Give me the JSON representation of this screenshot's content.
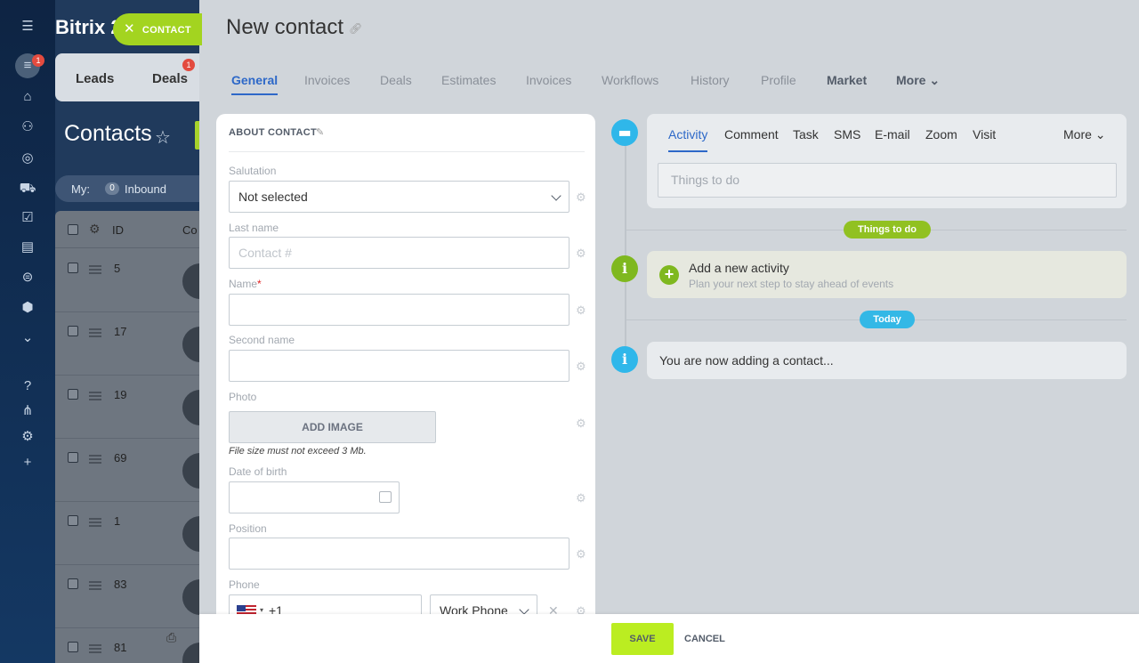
{
  "app": {
    "brand": "Bitrix 2",
    "rail_badge": "1"
  },
  "background": {
    "tabs": [
      "Leads",
      "Deals"
    ],
    "deals_badge": "1",
    "page_title": "Contacts",
    "filter": {
      "my": "My:",
      "count": "0",
      "inbound": "Inbound"
    },
    "grid_headers": {
      "id": "ID",
      "contact": "Co"
    },
    "rows": [
      "5",
      "17",
      "19",
      "69",
      "1",
      "83",
      "81"
    ]
  },
  "chip": {
    "label": "CONTACT"
  },
  "slider": {
    "title": "New contact",
    "tabs": [
      "General",
      "Invoices",
      "Deals",
      "Estimates",
      "Invoices",
      "Workflows",
      "History",
      "Profile",
      "Market",
      "More"
    ]
  },
  "form": {
    "section_title": "ABOUT CONTACT",
    "salutation": {
      "label": "Salutation",
      "value": "Not selected"
    },
    "last_name": {
      "label": "Last name",
      "placeholder": "Contact #"
    },
    "name": {
      "label": "Name",
      "required_mark": "*"
    },
    "second_name": {
      "label": "Second name"
    },
    "photo": {
      "label": "Photo",
      "button": "ADD IMAGE",
      "note": "File size must not exceed 3 Mb."
    },
    "dob": {
      "label": "Date of birth"
    },
    "position": {
      "label": "Position"
    },
    "phone": {
      "label": "Phone",
      "code": "+1",
      "type": "Work Phone"
    }
  },
  "timeline": {
    "tabs": [
      "Activity",
      "Comment",
      "Task",
      "SMS",
      "E-mail",
      "Zoom",
      "Visit",
      "More"
    ],
    "input_placeholder": "Things to do",
    "pill_todo": "Things to do",
    "new_activity_title": "Add a new activity",
    "new_activity_sub": "Plan your next step to stay ahead of events",
    "pill_today": "Today",
    "adding_text": "You are now adding a contact..."
  },
  "footer": {
    "save": "SAVE",
    "cancel": "CANCEL"
  },
  "colors": {
    "accent_blue": "#2d68c8",
    "save_green": "#bbed21",
    "chip_green": "#a3d420",
    "timeline_green": "#7fb81f",
    "timeline_blue": "#2fb7ea"
  }
}
